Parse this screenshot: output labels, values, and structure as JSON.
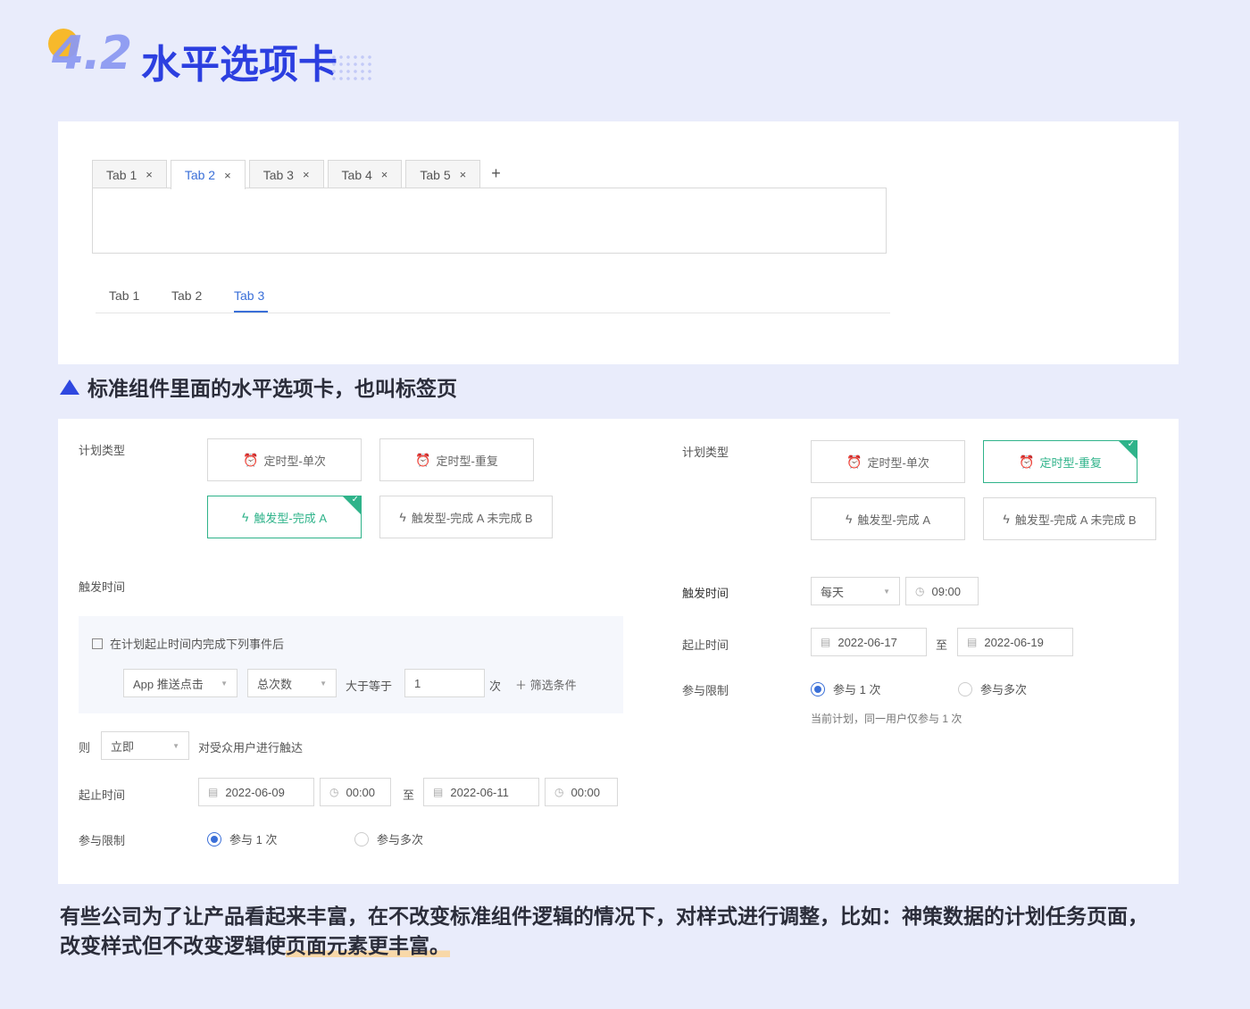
{
  "heading": {
    "number": "4.2",
    "text": "水平选项卡"
  },
  "card_tabs": {
    "tabs": [
      {
        "label": "Tab 1",
        "active": false
      },
      {
        "label": "Tab 2",
        "active": true
      },
      {
        "label": "Tab 3",
        "active": false
      },
      {
        "label": "Tab 4",
        "active": false
      },
      {
        "label": "Tab 5",
        "active": false
      }
    ],
    "close_glyph": "×",
    "add_glyph": "+"
  },
  "line_tabs": {
    "tabs": [
      {
        "label": "Tab 1",
        "active": false
      },
      {
        "label": "Tab 2",
        "active": false
      },
      {
        "label": "Tab 3",
        "active": true
      }
    ]
  },
  "caption": "标准组件里面的水平选项卡，也叫标签页",
  "left_form": {
    "plan_type_label": "计划类型",
    "options": [
      {
        "label": "定时型-单次",
        "icon": "alarm-clock-icon",
        "selected": false
      },
      {
        "label": "定时型-重复",
        "icon": "alarm-clock-icon",
        "selected": false
      },
      {
        "label": "触发型-完成 A",
        "icon": "lightning-icon",
        "selected": true
      },
      {
        "label": "触发型-完成 A 未完成 B",
        "icon": "lightning-icon",
        "selected": false
      }
    ],
    "trigger_time_label": "触发时间",
    "condition_checkbox": "在计划起止时间内完成下列事件后",
    "event_select": "App 推送点击",
    "metric_select": "总次数",
    "operator": "大于等于",
    "value": "1",
    "unit": "次",
    "add_filter": "筛选条件",
    "then_label": "则",
    "then_select": "立即",
    "then_text": "对受众用户进行触达",
    "range_label": "起止时间",
    "start_date": "2022-06-09",
    "start_time": "00:00",
    "range_sep": "至",
    "end_date": "2022-06-11",
    "end_time": "00:00",
    "limit_label": "参与限制",
    "limit_once": "参与 1 次",
    "limit_multi": "参与多次"
  },
  "right_form": {
    "plan_type_label": "计划类型",
    "options": [
      {
        "label": "定时型-单次",
        "icon": "alarm-clock-icon",
        "selected": false
      },
      {
        "label": "定时型-重复",
        "icon": "alarm-clock-icon",
        "selected": true
      },
      {
        "label": "触发型-完成 A",
        "icon": "lightning-icon",
        "selected": false
      },
      {
        "label": "触发型-完成 A 未完成 B",
        "icon": "lightning-icon",
        "selected": false
      }
    ],
    "trigger_time_label": "触发时间",
    "frequency_select": "每天",
    "trigger_time": "09:00",
    "range_label": "起止时间",
    "start_date": "2022-06-17",
    "range_sep": "至",
    "end_date": "2022-06-19",
    "limit_label": "参与限制",
    "limit_once": "参与 1 次",
    "limit_multi": "参与多次",
    "limit_hint": "当前计划，同一用户仅参与 1 次"
  },
  "bottom_text_1": "有些公司为了让产品看起来丰富，在不改变标准组件逻辑的情况下，对样式进行调整，比如：神策数据的计划任务页面，",
  "bottom_text_2a": "改变样式但不改变逻辑使",
  "bottom_text_2b": "页面元素更丰富。",
  "colors": {
    "accent": "#3a6fd8",
    "success": "#2fb38a",
    "title": "#2c3fe0",
    "background": "#e9ecfb"
  }
}
